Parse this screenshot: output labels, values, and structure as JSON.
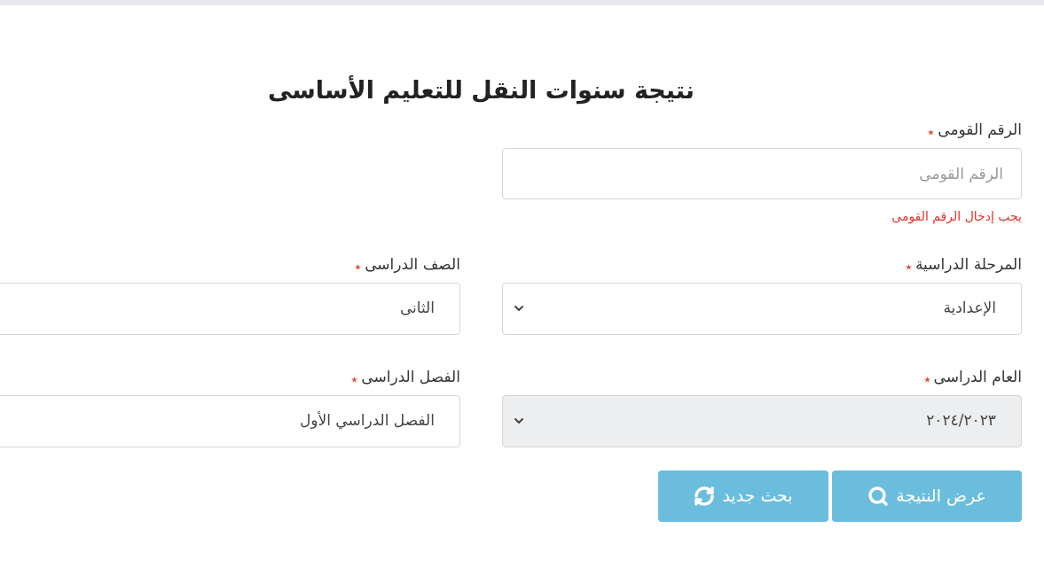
{
  "title": "نتيجة سنوات النقل للتعليم الأساسى",
  "national_id": {
    "label": "الرقم القومى",
    "required": true,
    "placeholder": "الرقم القومى",
    "error": "يجب إدخال الرقم القومى"
  },
  "fields": [
    {
      "label": "المرحلة الدراسية",
      "required": true,
      "kind": "select",
      "value": "الإعدادية",
      "disabled": false
    },
    {
      "label": "الصف الدراسى",
      "required": true,
      "kind": "input",
      "value": "الثانى",
      "disabled": false
    },
    {
      "label": "العام الدراسى",
      "required": true,
      "kind": "select",
      "value": "٢٠٢٤/٢٠٢٣",
      "disabled": true
    },
    {
      "label": "الفصل الدراسى",
      "required": true,
      "kind": "input",
      "value": "الفصل الدراسي الأول",
      "disabled": false
    }
  ],
  "buttons": [
    {
      "label": "عرض النتيجة",
      "kind": "search"
    },
    {
      "label": "بحث جديد",
      "kind": "refresh"
    }
  ]
}
